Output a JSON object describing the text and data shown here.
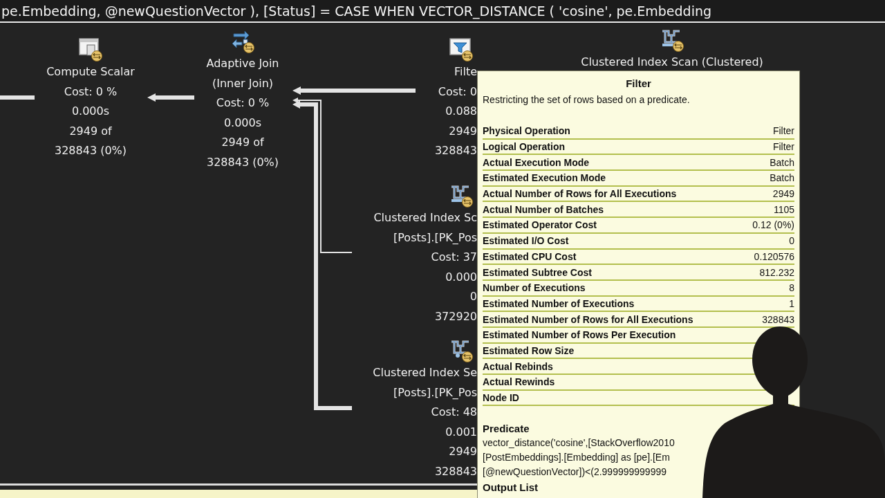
{
  "query_text": "pe.Embedding, @newQuestionVector ), [Status] = CASE WHEN VECTOR_DISTANCE ( 'cosine', pe.Embedding",
  "plan": {
    "nodes": [
      {
        "kind": "compute_scalar",
        "lines": [
          "Compute Scalar",
          "Cost: 0 %",
          "0.000s",
          "2949 of",
          "328843 (0%)"
        ]
      },
      {
        "kind": "adaptive_join",
        "lines": [
          "Adaptive Join",
          "(Inner Join)",
          "Cost: 0 %",
          "0.000s",
          "2949 of",
          "328843 (0%)"
        ]
      },
      {
        "kind": "filter",
        "lines": [
          "Filte",
          "Cost: 0",
          "0.088",
          "2949",
          "328843"
        ]
      },
      {
        "kind": "index_scan",
        "lines": [
          "Clustered Index Scan (Clustered)"
        ]
      },
      {
        "kind": "index_scan",
        "lines": [
          "Clustered Index Sc",
          "[Posts].[PK_Pos",
          "Cost: 37",
          "0.000",
          "0",
          "372920"
        ]
      },
      {
        "kind": "index_seek",
        "lines": [
          "Clustered Index Se",
          "[Posts].[PK_Pos",
          "Cost: 48",
          "0.001",
          "2949",
          "328843"
        ]
      }
    ]
  },
  "tooltip": {
    "title": "Filter",
    "description": "Restricting the set of rows based on a predicate.",
    "properties": [
      {
        "label": "Physical Operation",
        "value": "Filter"
      },
      {
        "label": "Logical Operation",
        "value": "Filter"
      },
      {
        "label": "Actual Execution Mode",
        "value": "Batch"
      },
      {
        "label": "Estimated Execution Mode",
        "value": "Batch"
      },
      {
        "label": "Actual Number of Rows for All Executions",
        "value": "2949"
      },
      {
        "label": "Actual Number of Batches",
        "value": "1105"
      },
      {
        "label": "Estimated Operator Cost",
        "value": "0.12 (0%)"
      },
      {
        "label": "Estimated I/O Cost",
        "value": "0"
      },
      {
        "label": "Estimated CPU Cost",
        "value": "0.120576"
      },
      {
        "label": "Estimated Subtree Cost",
        "value": "812.232"
      },
      {
        "label": "Number of Executions",
        "value": "8"
      },
      {
        "label": "Estimated Number of Executions",
        "value": "1"
      },
      {
        "label": "Estimated Number of Rows for All Executions",
        "value": "328843"
      },
      {
        "label": "Estimated Number of Rows Per Execution"
      },
      {
        "label": "Estimated Row Size"
      },
      {
        "label": "Actual Rebinds"
      },
      {
        "label": "Actual Rewinds"
      },
      {
        "label": "Node ID"
      }
    ],
    "sections": [
      {
        "heading": "Predicate",
        "lines": [
          "vector_distance('cosine',[StackOverflow2010",
          "[PostEmbeddings].[Embedding] as [pe].[Em",
          "[@newQuestionVector])<(2.999999999999"
        ]
      },
      {
        "heading": "Output List"
      }
    ]
  }
}
